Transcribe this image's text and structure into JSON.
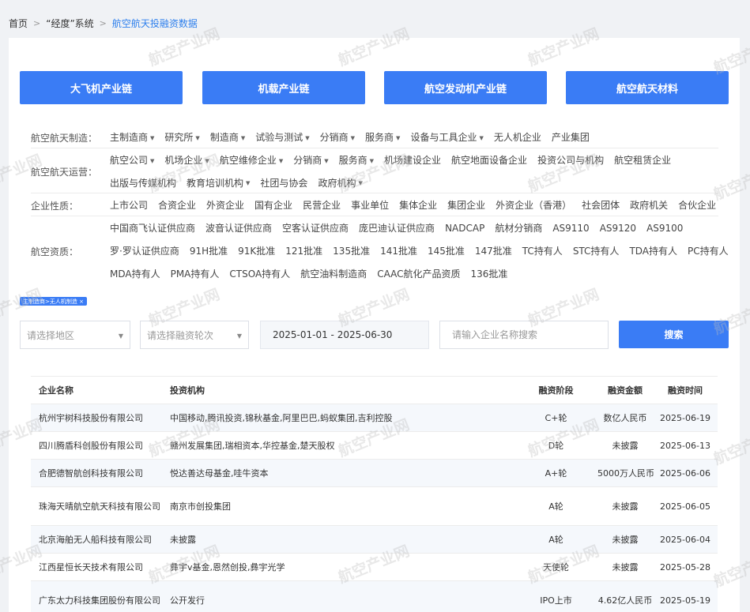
{
  "breadcrumb": {
    "home": "首页",
    "system": "“经度”系统",
    "current": "航空航天投融资数据",
    "sep": ">"
  },
  "chains": [
    "大飞机产业链",
    "机载产业链",
    "航空发动机产业链",
    "航空航天材料"
  ],
  "filters": {
    "manufacturing": {
      "label": "航空航天制造：",
      "items": [
        {
          "text": "主制造商",
          "arrow": true
        },
        {
          "text": "研究所",
          "arrow": true
        },
        {
          "text": "制造商",
          "arrow": true
        },
        {
          "text": "试验与测试",
          "arrow": true
        },
        {
          "text": "分销商",
          "arrow": true
        },
        {
          "text": "服务商",
          "arrow": true
        },
        {
          "text": "设备与工具企业",
          "arrow": true
        },
        {
          "text": "无人机企业",
          "arrow": false
        },
        {
          "text": "产业集团",
          "arrow": false
        }
      ]
    },
    "operation": {
      "label": "航空航天运营：",
      "line1": [
        {
          "text": "航空公司",
          "arrow": true
        },
        {
          "text": "机场企业",
          "arrow": true
        },
        {
          "text": "航空维修企业",
          "arrow": true
        },
        {
          "text": "分销商",
          "arrow": true
        },
        {
          "text": "服务商",
          "arrow": true
        },
        {
          "text": "机场建设企业",
          "arrow": false
        },
        {
          "text": "航空地面设备企业",
          "arrow": false
        },
        {
          "text": "投资公司与机构",
          "arrow": false
        },
        {
          "text": "航空租赁企业",
          "arrow": false
        }
      ],
      "line2": [
        {
          "text": "出版与传媒机构",
          "arrow": false
        },
        {
          "text": "教育培训机构",
          "arrow": true
        },
        {
          "text": "社团与协会",
          "arrow": false
        },
        {
          "text": "政府机构",
          "arrow": true
        }
      ]
    },
    "nature": {
      "label": "企业性质：",
      "items": [
        "上市公司",
        "合资企业",
        "外资企业",
        "国有企业",
        "民营企业",
        "事业单位",
        "集体企业",
        "集团企业",
        "外资企业（香港）",
        "社会团体",
        "政府机关",
        "合伙企业"
      ]
    },
    "qualification": {
      "label": "航空资质：",
      "line1": [
        "中国商飞认证供应商",
        "波音认证供应商",
        "空客认证供应商",
        "庞巴迪认证供应商",
        "NADCAP",
        "航材分销商",
        "AS9110",
        "AS9120",
        "AS9100"
      ],
      "line2": [
        "罗·罗认证供应商",
        "91H批准",
        "91K批准",
        "121批准",
        "135批准",
        "141批准",
        "145批准",
        "147批准",
        "TC持有人",
        "STC持有人",
        "TDA持有人",
        "PC持有人"
      ],
      "line3": [
        "MDA持有人",
        "PMA持有人",
        "CTSOA持有人",
        "航空油料制造商",
        "CAAC航化产品资质",
        "136批准"
      ]
    }
  },
  "active_tag": "主制造商>无人机制造 ×",
  "search": {
    "region_placeholder": "请选择地区",
    "round_placeholder": "请选择融资轮次",
    "date_range": "2025-01-01 - 2025-06-30",
    "name_placeholder": "请输入企业名称搜索",
    "button": "搜索"
  },
  "table": {
    "headers": [
      "企业名称",
      "投资机构",
      "融资阶段",
      "融资金额",
      "融资时间"
    ],
    "rows": [
      {
        "company": "杭州宇树科技股份有限公司",
        "investors": "中国移动,腾讯投资,锦秋基金,阿里巴巴,蚂蚁集团,吉利控股",
        "stage": "C+轮",
        "amount": "数亿人民币",
        "date": "2025-06-19"
      },
      {
        "company": "四川腾盾科创股份有限公司",
        "investors": "赣州发展集团,瑞相资本,华控基金,楚天股权",
        "stage": "D轮",
        "amount": "未披露",
        "date": "2025-06-13"
      },
      {
        "company": "合肥德智航创科技有限公司",
        "investors": "悦达善达母基金,哇牛资本",
        "stage": "A+轮",
        "amount": "5000万人民币",
        "date": "2025-06-06"
      },
      {
        "company": "珠海天晴航空航天科技有限公司",
        "investors": "南京市创投集团",
        "stage": "A轮",
        "amount": "未披露",
        "date": "2025-06-05"
      },
      {
        "company": "北京海舶无人船科技有限公司",
        "investors": "未披露",
        "stage": "A轮",
        "amount": "未披露",
        "date": "2025-06-04"
      },
      {
        "company": "江西星恒长天技术有限公司",
        "investors": "彝宇v基金,恩然创投,彝宇光学",
        "stage": "天使轮",
        "amount": "未披露",
        "date": "2025-05-28"
      },
      {
        "company": "广东太力科技集团股份有限公司",
        "investors": "公开发行",
        "stage": "IPO上市",
        "amount": "4.62亿人民币",
        "date": "2025-05-19"
      }
    ]
  },
  "watermark": "航空产业网"
}
